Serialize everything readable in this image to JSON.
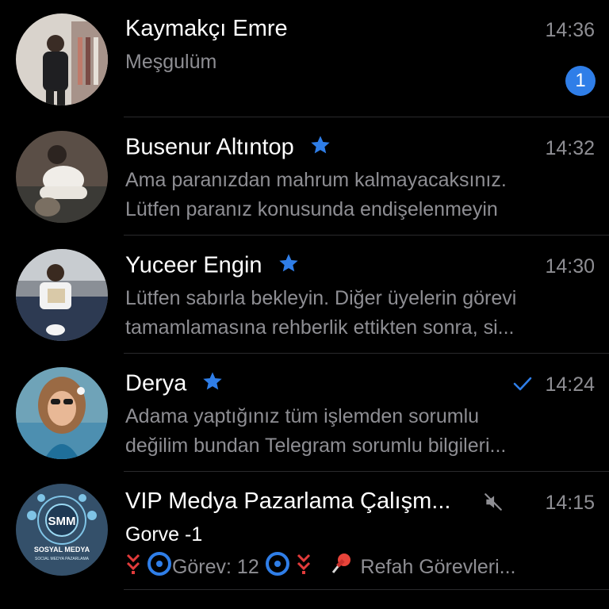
{
  "chats": [
    {
      "name": "Kaymakçı Emre",
      "time": "14:36",
      "preview": [
        "Meşgulüm"
      ],
      "unread": "1"
    },
    {
      "name": "Busenur Altıntop",
      "time": "14:32",
      "preview": [
        "Ama paranızdan mahrum kalmayacaksınız.",
        "Lütfen paranız konusunda endişelenmeyin"
      ],
      "starred": true
    },
    {
      "name": "Yuceer Engin",
      "time": "14:30",
      "preview": [
        "Lütfen sabırla bekleyin. Diğer üyelerin görevi",
        "tamamlamasına rehberlik ettikten sonra, si..."
      ],
      "starred": true
    },
    {
      "name": "Derya",
      "time": "14:24",
      "preview": [
        "Adama yaptığınız tüm işlemden sorumlu",
        "değilim bundan Telegram sorumlu bilgileri..."
      ],
      "starred": true,
      "read_check": true
    },
    {
      "name": "VIP Medya Pazarlama Çalışm...",
      "time": "14:15",
      "sender": "Gorve -1",
      "preview_parts": {
        "task": "Görev: 12",
        "rest": "Refah Görevleri..."
      },
      "muted": true,
      "logo": {
        "top": "SMM",
        "line1": "SOSYAL MEDYA",
        "line2": "SOCIAL MEDYA PAZARLAMA"
      }
    }
  ],
  "colors": {
    "accent": "#2f7ee8",
    "secondary_text": "#8e8e93",
    "divider": "#2a2a2c"
  },
  "icons": [
    "star-icon",
    "check-icon",
    "mute-icon",
    "down-arrows-icon",
    "refresh-icon",
    "pushpin-icon"
  ]
}
